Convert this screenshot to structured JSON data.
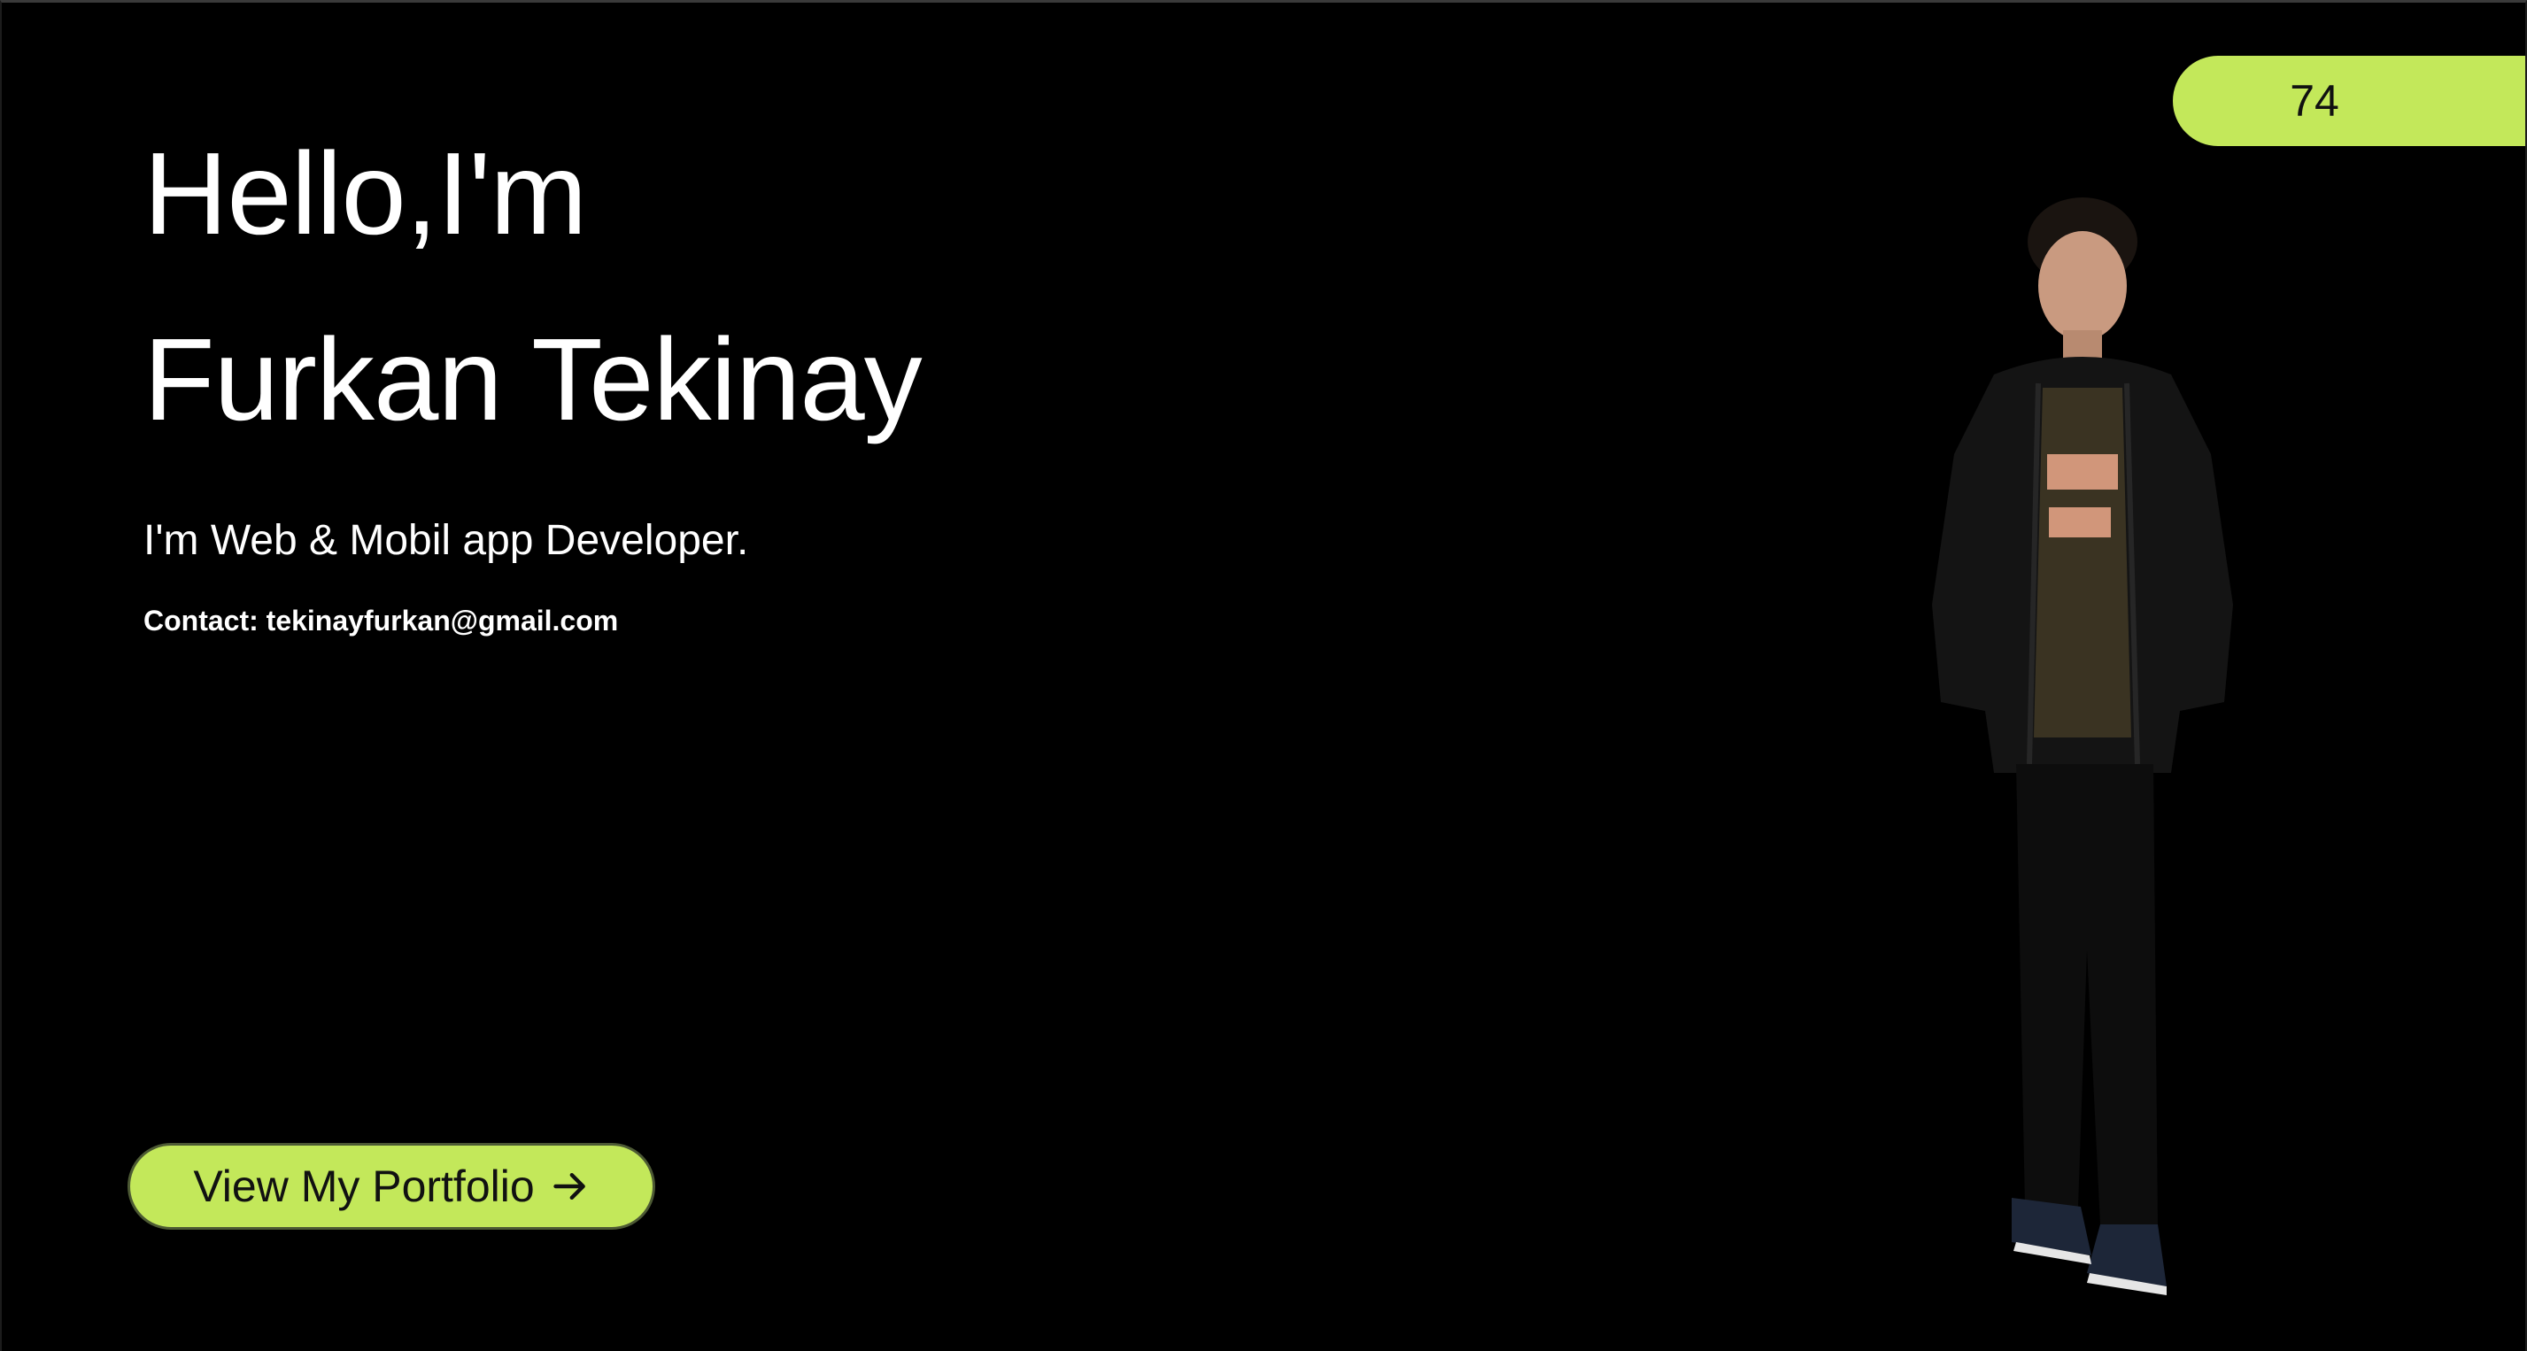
{
  "counter": {
    "value": "74"
  },
  "hero": {
    "greeting": "Hello,I'm",
    "name": "Furkan Tekinay",
    "tagline": "I'm Web & Mobil app Developer.",
    "contact": "Contact: tekinayfurkan@gmail.com"
  },
  "cta": {
    "label": "View My Portfolio",
    "icon": "arrow-right-icon"
  },
  "colors": {
    "background": "#000000",
    "accent": "#c3e85a",
    "text": "#ffffff",
    "button_text": "#111111"
  }
}
